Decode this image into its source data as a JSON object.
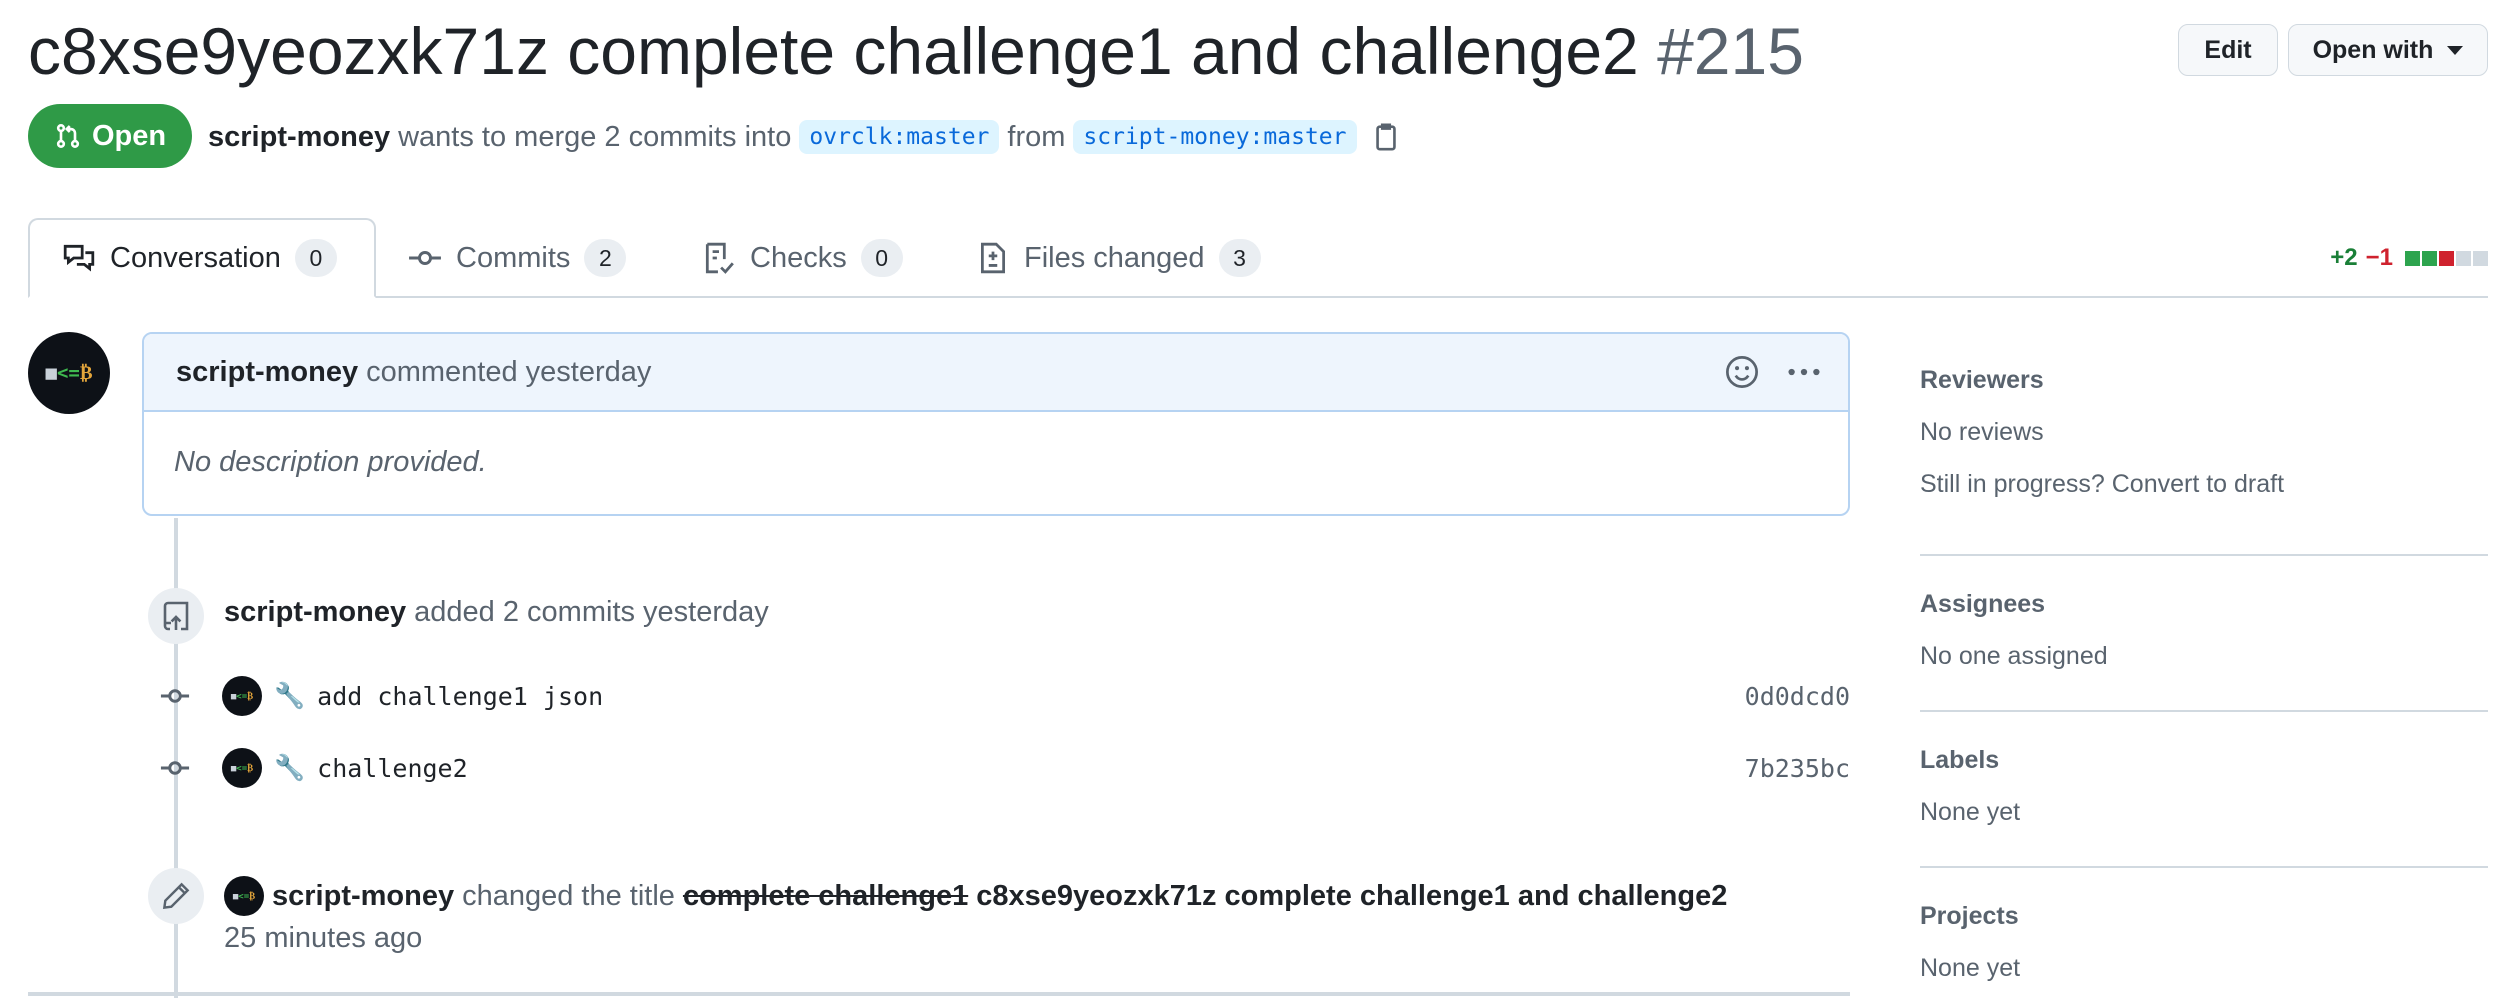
{
  "pr": {
    "title": "c8xse9yeozxk71z complete challenge1 and challenge2",
    "number": "#215",
    "state": "Open",
    "author": "script-money",
    "meta_text": "wants to merge 2 commits into",
    "base_branch": "ovrclk:master",
    "from_text": "from",
    "head_branch": "script-money:master"
  },
  "header_buttons": {
    "edit": "Edit",
    "open_with": "Open with"
  },
  "tabs": [
    {
      "label": "Conversation",
      "count": "0",
      "icon": "comment-discussion-icon"
    },
    {
      "label": "Commits",
      "count": "2",
      "icon": "git-commit-icon"
    },
    {
      "label": "Checks",
      "count": "0",
      "icon": "checklist-icon"
    },
    {
      "label": "Files changed",
      "count": "3",
      "icon": "file-diff-icon"
    }
  ],
  "diffstat": {
    "additions": "+2",
    "deletions": "−1"
  },
  "comment": {
    "author": "script-money",
    "action": "commented yesterday",
    "body": "No description provided."
  },
  "commits_event": {
    "author": "script-money",
    "text": "added 2 commits yesterday"
  },
  "commits": [
    {
      "emoji": "🔧",
      "message": "add challenge1 json",
      "sha": "0d0dcd0"
    },
    {
      "emoji": "🔧",
      "message": "challenge2",
      "sha": "7b235bc"
    }
  ],
  "rename_event": {
    "author": "script-money",
    "text": "changed the title",
    "old_title": "complete challenge1",
    "new_title": "c8xse9yeozxk71z complete challenge1 and challenge2",
    "time": "25 minutes ago"
  },
  "sidebar": {
    "reviewers": {
      "heading": "Reviewers",
      "value": "No reviews",
      "extra": "Still in progress? Convert to draft"
    },
    "assignees": {
      "heading": "Assignees",
      "value": "No one assigned"
    },
    "labels": {
      "heading": "Labels",
      "value": "None yet"
    },
    "projects": {
      "heading": "Projects",
      "value": "None yet"
    }
  },
  "colors": {
    "open_green": "#2f9a47",
    "link_blue": "#0969da",
    "add_green": "#1a7f37",
    "del_red": "#cf222e"
  }
}
